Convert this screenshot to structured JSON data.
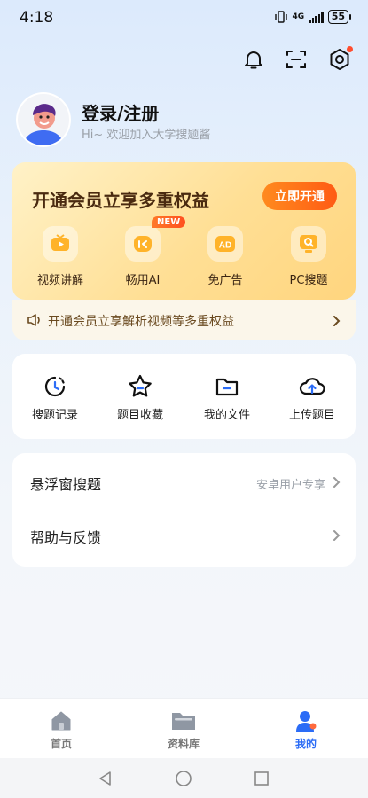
{
  "status": {
    "time": "4:18",
    "network": "4G",
    "battery": "55"
  },
  "profile": {
    "name": "登录/注册",
    "subtitle": "Hi~ 欢迎加入大学搜题酱"
  },
  "vip": {
    "title": "开通会员立享多重权益",
    "button": "立即开通",
    "new_badge": "NEW",
    "perks": [
      {
        "label": "视频讲解",
        "icon": "tv-icon"
      },
      {
        "label": "畅用AI",
        "icon": "ai-icon"
      },
      {
        "label": "免广告",
        "icon": "ad-icon"
      },
      {
        "label": "PC搜题",
        "icon": "pc-search-icon"
      }
    ],
    "notice": "开通会员立享解析视频等多重权益"
  },
  "tools": [
    {
      "label": "搜题记录",
      "icon": "clock-icon"
    },
    {
      "label": "题目收藏",
      "icon": "star-icon"
    },
    {
      "label": "我的文件",
      "icon": "folder-icon"
    },
    {
      "label": "上传题目",
      "icon": "cloud-upload-icon"
    }
  ],
  "list": [
    {
      "label": "悬浮窗搜题",
      "hint": "安卓用户专享"
    },
    {
      "label": "帮助与反馈",
      "hint": ""
    }
  ],
  "nav": [
    {
      "label": "首页",
      "icon": "home-icon"
    },
    {
      "label": "资料库",
      "icon": "folder-icon"
    },
    {
      "label": "我的",
      "icon": "user-icon"
    }
  ],
  "colors": {
    "accent": "#2b6cf6",
    "vip_button": "#ff5b14",
    "badge": "#ff4d2e"
  }
}
